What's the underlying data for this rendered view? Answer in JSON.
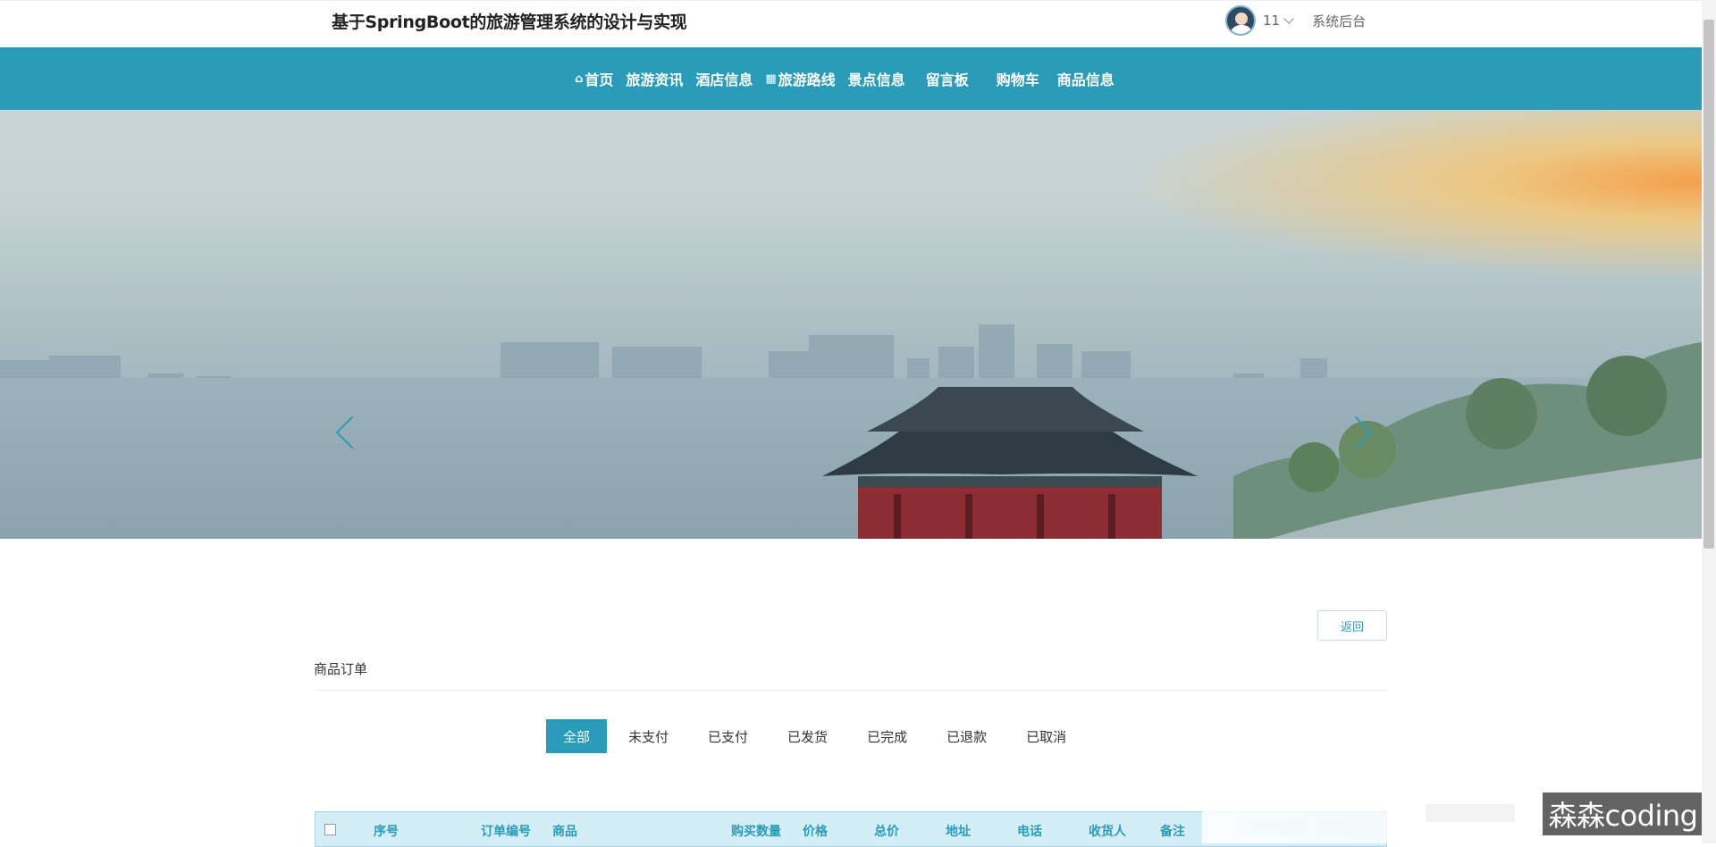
{
  "header": {
    "site_title": "基于SpringBoot的旅游管理系统的设计与实现",
    "user_name": "11",
    "admin_link": "系统后台"
  },
  "nav": {
    "items": [
      {
        "label": "首页",
        "icon": "home-icon"
      },
      {
        "label": "旅游资讯",
        "icon": ""
      },
      {
        "label": "酒店信息",
        "icon": ""
      },
      {
        "label": "旅游路线",
        "icon": "table-icon"
      },
      {
        "label": "景点信息",
        "icon": ""
      },
      {
        "label": "留言板",
        "icon": ""
      },
      {
        "label": "购物车",
        "icon": ""
      },
      {
        "label": "商品信息",
        "icon": ""
      }
    ]
  },
  "page": {
    "back_button": "返回",
    "section_title": "商品订单"
  },
  "tabs": [
    {
      "label": "全部",
      "active": true
    },
    {
      "label": "未支付",
      "active": false
    },
    {
      "label": "已支付",
      "active": false
    },
    {
      "label": "已发货",
      "active": false
    },
    {
      "label": "已完成",
      "active": false
    },
    {
      "label": "已退款",
      "active": false
    },
    {
      "label": "已取消",
      "active": false
    }
  ],
  "table": {
    "columns": [
      "序号",
      "订单编号",
      "商品",
      "购买数量",
      "价格",
      "总价",
      "地址",
      "电话",
      "收货人",
      "备注"
    ]
  },
  "watermark": "森森coding",
  "colors": {
    "accent": "#2a9bb8",
    "table_header_bg": "#d4eef6"
  }
}
